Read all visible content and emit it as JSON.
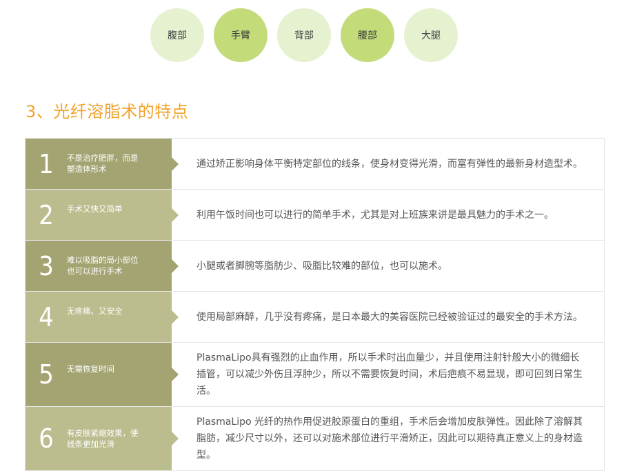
{
  "tabs": [
    {
      "label": "腹部",
      "active": false
    },
    {
      "label": "手臂",
      "active": true
    },
    {
      "label": "背部",
      "active": false
    },
    {
      "label": "腰部",
      "active": true
    },
    {
      "label": "大腿",
      "active": false
    }
  ],
  "section_title": "3、光纤溶脂术的特点",
  "features": [
    {
      "num": "1",
      "label": "不是治疗肥胖，而是塑造体形术",
      "desc": "通过矫正影响身体平衡特定部位的线条，使身材变得光滑，而富有弹性的最新身材造型术。"
    },
    {
      "num": "2",
      "label": "手术又快又简单",
      "desc": "利用午饭时间也可以进行的简单手术，尤其是对上班族来讲是最具魅力的手术之一。"
    },
    {
      "num": "3",
      "label": "难以吸脂的局小部位也可以进行手术",
      "desc": "小腿或者脚腕等脂肪少、吸脂比较难的部位，也可以施术。"
    },
    {
      "num": "4",
      "label": "无疼痛、又安全",
      "desc": "使用局部麻醉，几乎没有疼痛，是日本最大的美容医院已经被验证过的最安全的手术方法。"
    },
    {
      "num": "5",
      "label": "无需恢复时间",
      "desc": "PlasmaLipo具有强烈的止血作用，所以手术时出血量少，并且使用注射针般大小的微细长插管，可以减少外伤且浮肿少，所以不需要恢复时间，术后疤痕不易显现，即可回到日常生活。"
    },
    {
      "num": "6",
      "label": "有皮肤紧缩效果，使线条更加光滑",
      "desc": "PlasmaLipo 光纤的热作用促进胶原蛋白的重组，手术后会增加皮肤弹性。因此除了溶解其脂肪，减少尺寸以外，还可以对施术部位进行平滑矫正，因此可以期待真正意义上的身材造型。"
    }
  ],
  "colors": {
    "accent": "#f2a22b",
    "row_dark": "#a3a472",
    "row_light": "#bbbd8f",
    "circle_light": "#e6f1cf",
    "circle_dark": "#c3dc79"
  }
}
